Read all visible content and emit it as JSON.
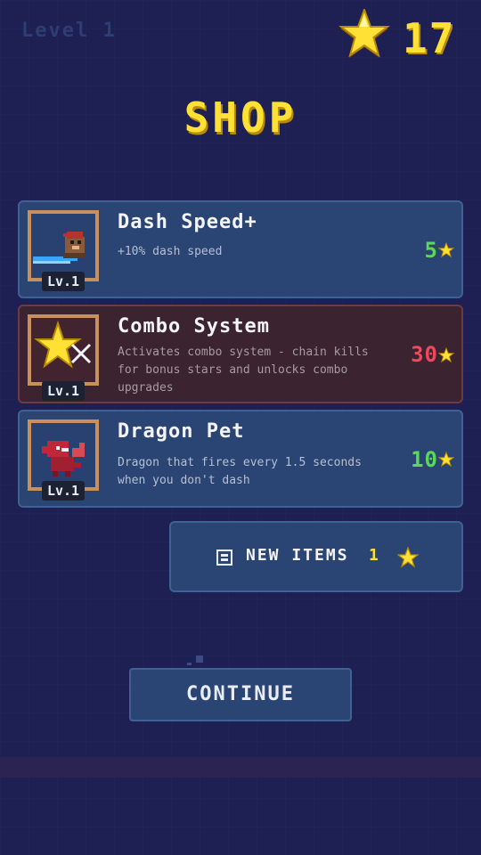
{
  "hud": {
    "level_label": "Level 1",
    "star_count": "17",
    "star_icon": "star-icon"
  },
  "shop": {
    "title": "SHOP",
    "items": [
      {
        "name": "Dash Speed+",
        "description": "+10% dash speed",
        "level": "Lv.1",
        "price": "5",
        "price_color": "#5ad85a",
        "icon": "dash-character-icon",
        "selected": false
      },
      {
        "name": "Combo System",
        "description": "Activates combo system - chain kills for bonus stars and unlocks combo upgrades",
        "level": "Lv.1",
        "price": "30",
        "price_color": "#ea4a5d",
        "icon": "combo-star-icon",
        "selected": true
      },
      {
        "name": "Dragon Pet",
        "description": "Dragon that fires every 1.5 seconds when you don't dash",
        "level": "Lv.1",
        "price": "10",
        "price_color": "#5ad85a",
        "icon": "dragon-icon",
        "selected": false
      }
    ],
    "new_items": {
      "label": "NEW ITEMS",
      "cost": "1"
    },
    "continue_label": "CONTINUE"
  },
  "colors": {
    "background": "#1e1f52",
    "card": "#2a4573",
    "card_selected": "#3b2330",
    "accent_star": "#ffe135"
  }
}
